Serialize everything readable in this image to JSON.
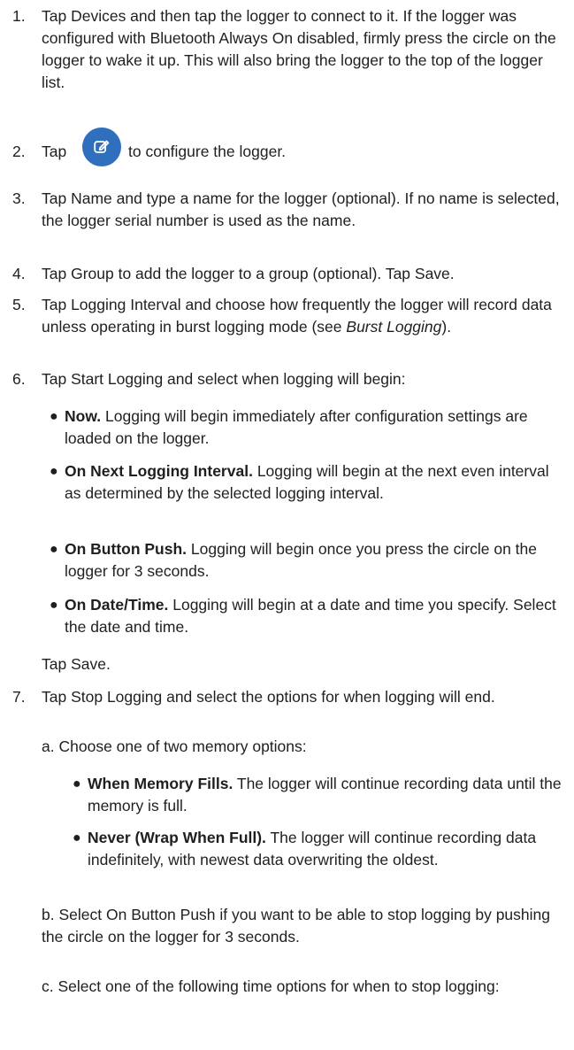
{
  "steps": [
    {
      "number": "1.",
      "text": "Tap Devices and then tap the logger to connect to it. If the logger was configured with Bluetooth Always On disabled, firmly press the circle on the logger to wake it up. This will also bring the logger to the top of the logger list."
    },
    {
      "number": "2.",
      "before_icon": "Tap",
      "icon": "edit-config-icon",
      "after_icon": "to configure the logger."
    },
    {
      "number": "3.",
      "text": "Tap Name and type a name for the logger (optional). If no name is selected, the logger serial number is used as the name."
    },
    {
      "number": "4.",
      "text": "Tap Group to add the logger to a group (optional). Tap Save."
    },
    {
      "number": "5.",
      "text_before": "Tap Logging Interval and choose how frequently the logger will record data unless operating in burst logging mode (see",
      "link": "Burst Logging",
      "text_after": ")."
    },
    {
      "number": "6.",
      "text": "Tap Start Logging and select when logging will begin:",
      "bullets": [
        {
          "bold": "Now.",
          "text": "Logging will begin immediately after configuration settings are loaded on the logger."
        },
        {
          "bold": "On Next Logging Interval.",
          "text": "Logging will begin at the next even interval as determined by the selected logging interval."
        },
        {
          "bold": "On Button Push.",
          "text": "Logging will begin once you press the circle on the logger for 3 seconds."
        },
        {
          "bold": "On Date/Time.",
          "text": "Logging will begin at a date and time you specify. Select the date and time."
        }
      ],
      "tail": "Tap Save."
    },
    {
      "number": "7.",
      "text": "Tap Stop Logging and select the options for when logging will end.",
      "subs": [
        {
          "label": "a.",
          "text": "Choose one of two memory options:",
          "bullets": [
            {
              "bold": "When Memory Fills.",
              "text": "The logger will continue recording data until the memory is full."
            },
            {
              "bold": "Never (Wrap When Full).",
              "text": "The logger will continue recording data indefinitely, with newest data overwriting the oldest."
            }
          ]
        },
        {
          "label": "b.",
          "text": "Select On Button Push if you want to be able to stop logging by pushing the circle on the logger for 3 seconds."
        },
        {
          "label": "c.",
          "text": "Select one of the following time options for when to stop logging:"
        }
      ]
    }
  ],
  "colors": {
    "icon_background": "#2f6fbe",
    "text": "#1f1f1f"
  }
}
